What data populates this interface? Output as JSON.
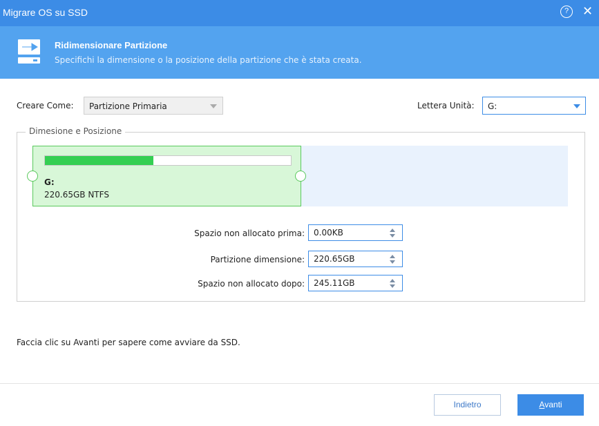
{
  "window": {
    "title": "Migrare OS su SSD",
    "help_icon": "question-circle-icon",
    "help_glyph": "?",
    "close_icon": "close-icon",
    "close_glyph": "✕",
    "accent_color": "#3c8ce6"
  },
  "header": {
    "icon": "disk-migrate-icon",
    "title": "Ridimensionare Partizione",
    "subtitle": "Specifichi la dimensione o la posizione della partizione che è stata creata."
  },
  "form": {
    "create_as_label": "Creare Come:",
    "create_as_value": "Partizione Primaria",
    "drive_letter_label": "Lettera Unità:",
    "drive_letter_value": "G:"
  },
  "group": {
    "legend": "Dimesione e Posizione"
  },
  "partition": {
    "letter": "G:",
    "info": "220.65GB NTFS",
    "used_fraction": 0.44,
    "color": "#34cf52"
  },
  "fields": {
    "before_label": "Spazio non allocato prima:",
    "before_value": "0.00KB",
    "size_label": "Partizione dimensione:",
    "size_value": "220.65GB",
    "after_label": "Spazio non allocato dopo:",
    "after_value": "245.11GB"
  },
  "hint": "Faccia clic su Avanti per sapere come avviare da SSD.",
  "buttons": {
    "back": "Indietro",
    "next_accel": "A",
    "next_rest": "vanti"
  }
}
